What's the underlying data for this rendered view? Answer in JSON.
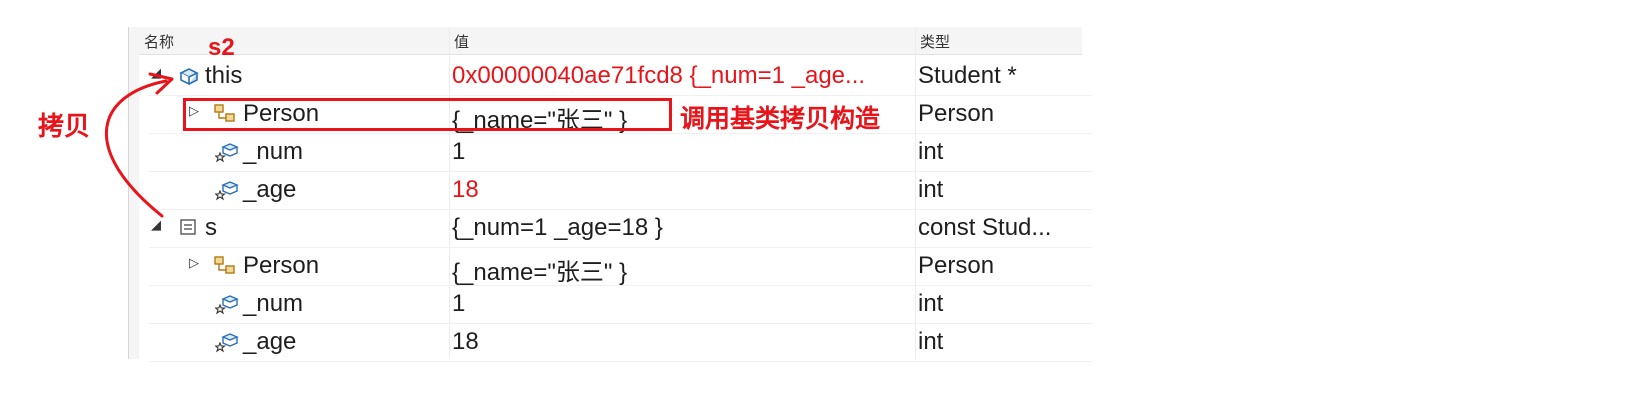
{
  "columns": {
    "name": "名称",
    "value": "值",
    "type": "类型"
  },
  "rows": [
    {
      "name": "this",
      "value": "0x00000040ae71fcd8 {_num=1 _age...",
      "type": "Student *",
      "expander": "expanded",
      "icon": "object-pointer-icon",
      "value_changed": true
    },
    {
      "name": "Person",
      "value": "{_name=\"张三\" }",
      "type": "Person",
      "expander": "collapsed",
      "icon": "base-class-icon"
    },
    {
      "name": "_num",
      "value": "1",
      "type": "int",
      "expander": "none",
      "icon": "field-icon"
    },
    {
      "name": "_age",
      "value": "18",
      "type": "int",
      "expander": "none",
      "icon": "field-icon",
      "value_changed": true
    },
    {
      "name": "s",
      "value": "{_num=1 _age=18 }",
      "type": "const Stud...",
      "expander": "expanded",
      "icon": "variable-icon"
    },
    {
      "name": "Person",
      "value": "{_name=\"张三\" }",
      "type": "Person",
      "expander": "collapsed",
      "icon": "base-class-icon"
    },
    {
      "name": "_num",
      "value": "1",
      "type": "int",
      "expander": "none",
      "icon": "field-icon"
    },
    {
      "name": "_age",
      "value": "18",
      "type": "int",
      "expander": "none",
      "icon": "field-icon"
    }
  ],
  "annotations": {
    "s2_label": "s2",
    "copy_label": "拷贝",
    "callout_label": "调用基类拷贝构造"
  },
  "colors": {
    "annotation": "#e8141a",
    "changed_value": "#e8141a"
  }
}
